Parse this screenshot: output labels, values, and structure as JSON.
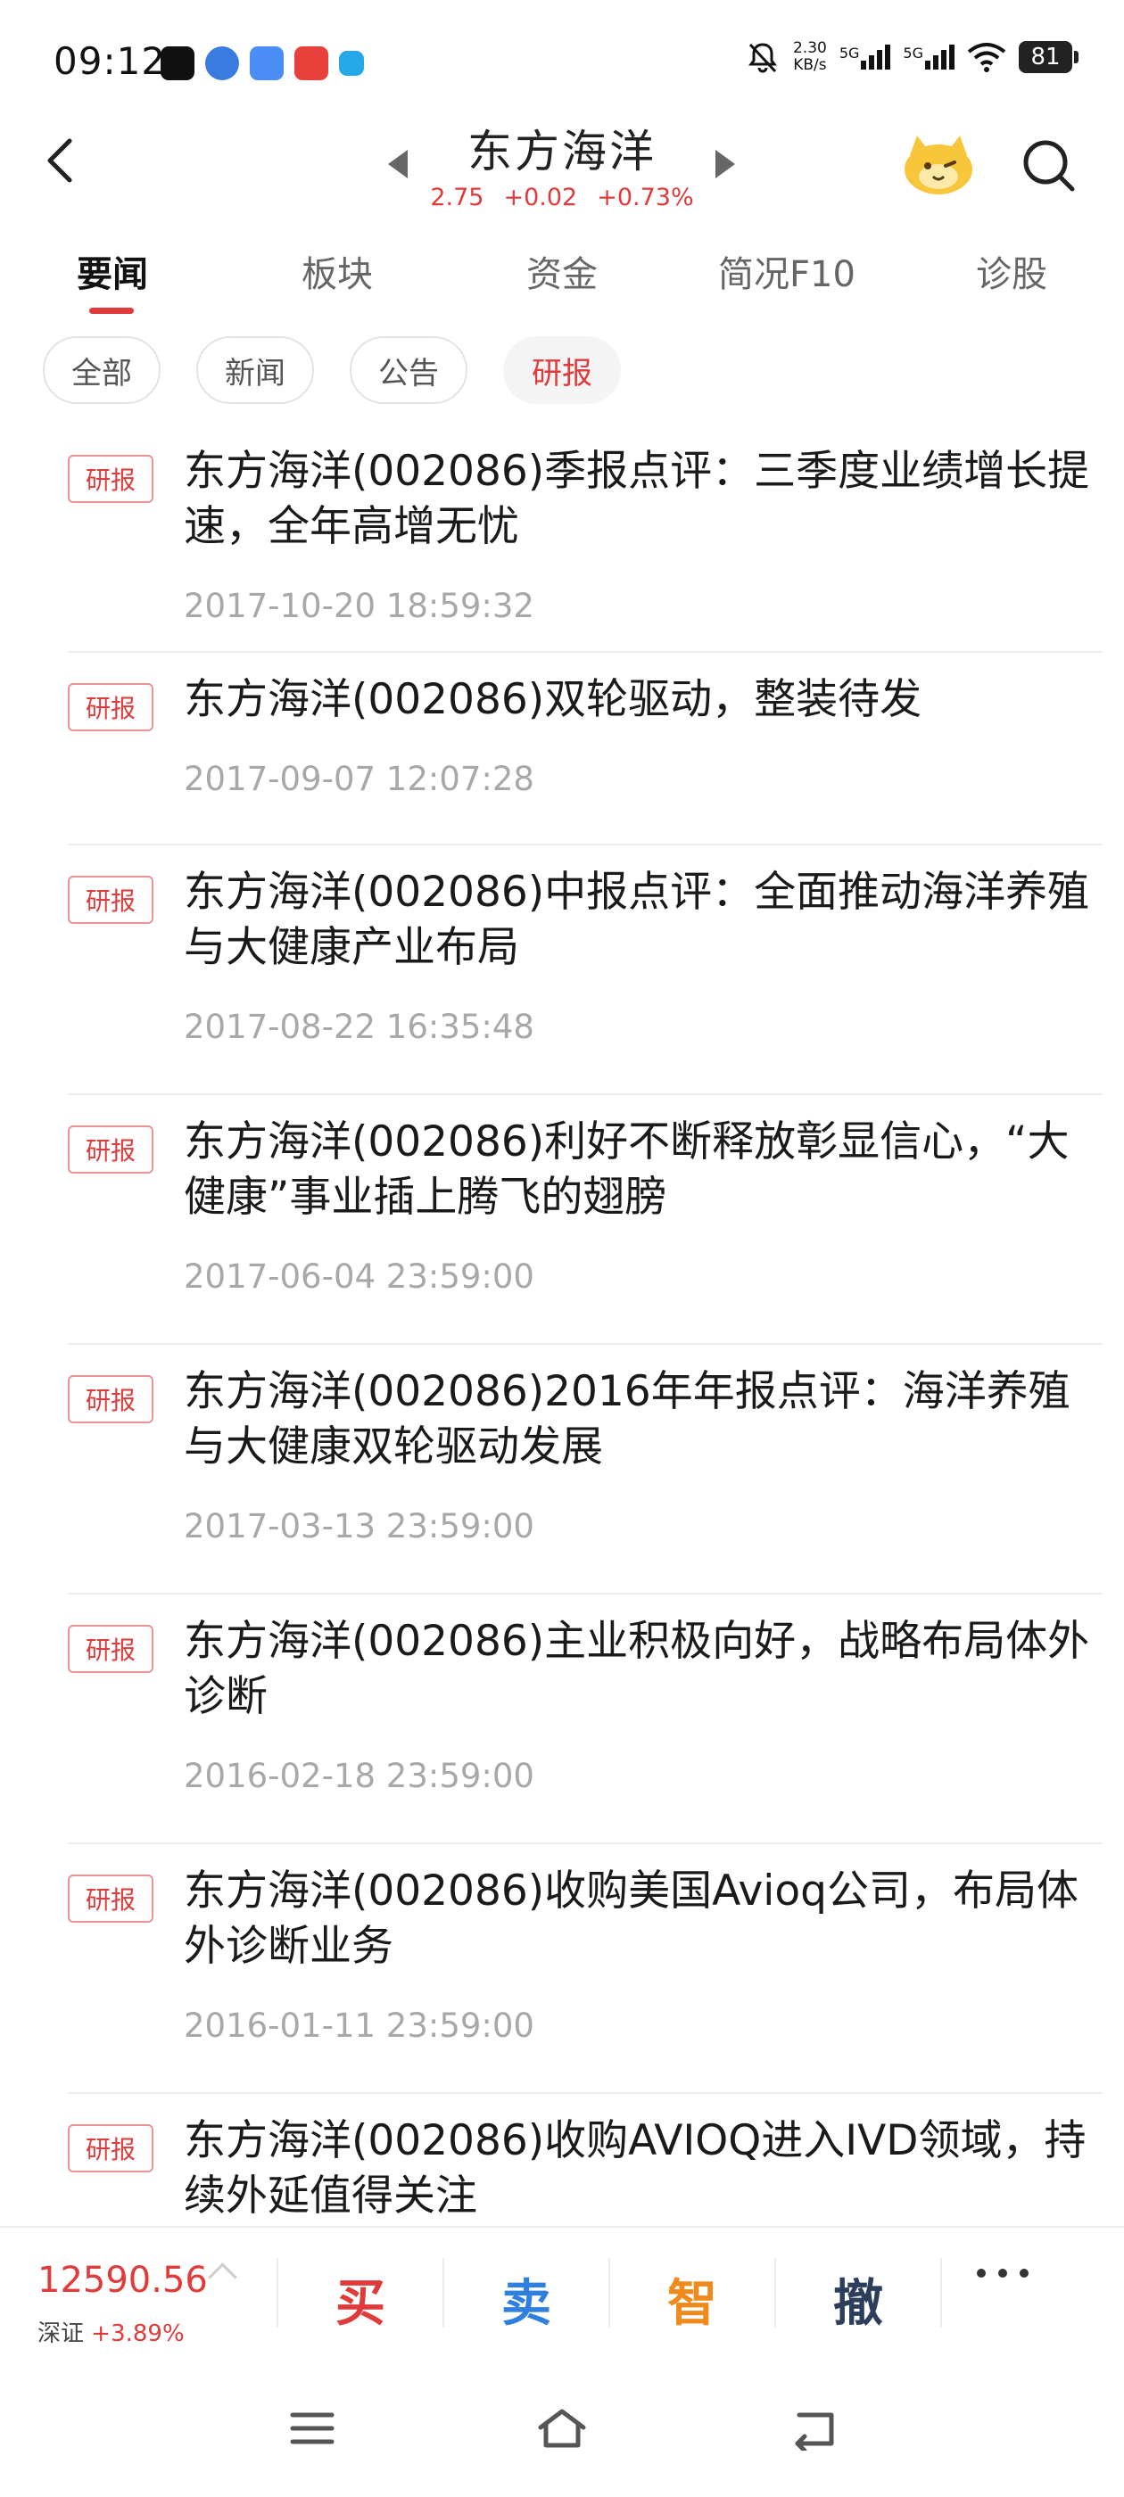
{
  "status_bar": {
    "time": "09:12",
    "net_speed_value": "2.30",
    "net_speed_unit": "KB/s",
    "sim1": "5G",
    "sim2": "5G",
    "battery": "81"
  },
  "header": {
    "stock_name": "东方海洋",
    "price": "2.75",
    "change": "+0.02",
    "change_pct": "+0.73%"
  },
  "tabs": [
    {
      "label": "要闻",
      "active": true
    },
    {
      "label": "板块",
      "active": false
    },
    {
      "label": "资金",
      "active": false
    },
    {
      "label": "简况F10",
      "active": false
    },
    {
      "label": "诊股",
      "active": false
    }
  ],
  "filters": [
    {
      "label": "全部",
      "active": false
    },
    {
      "label": "新闻",
      "active": false
    },
    {
      "label": "公告",
      "active": false
    },
    {
      "label": "研报",
      "active": true
    }
  ],
  "reports": [
    {
      "tag": "研报",
      "title": "东方海洋(002086)季报点评：三季度业绩增长提速，全年高增无忧",
      "time": "2017-10-20 18:59:32"
    },
    {
      "tag": "研报",
      "title": "东方海洋(002086)双轮驱动，整装待发",
      "time": "2017-09-07 12:07:28"
    },
    {
      "tag": "研报",
      "title": "东方海洋(002086)中报点评：全面推动海洋养殖与大健康产业布局",
      "time": "2017-08-22 16:35:48"
    },
    {
      "tag": "研报",
      "title": "东方海洋(002086)利好不断释放彰显信心，“大健康”事业插上腾飞的翅膀",
      "time": "2017-06-04 23:59:00"
    },
    {
      "tag": "研报",
      "title": "东方海洋(002086)2016年年报点评：海洋养殖与大健康双轮驱动发展",
      "time": "2017-03-13 23:59:00"
    },
    {
      "tag": "研报",
      "title": "东方海洋(002086)主业积极向好，战略布局体外诊断",
      "time": "2016-02-18 23:59:00"
    },
    {
      "tag": "研报",
      "title": "东方海洋(002086)收购美国Avioq公司，布局体外诊断业务",
      "time": "2016-01-11 23:59:00"
    },
    {
      "tag": "研报",
      "title": "东方海洋(002086)收购AVIOQ进入IVD领域，持续外延值得关注",
      "time": ""
    }
  ],
  "trade_bar": {
    "index_value": "12590.56",
    "index_name": "深证",
    "index_change": "+3.89%",
    "buy": "买",
    "sell": "卖",
    "smart": "智",
    "cancel": "撤"
  },
  "colors": {
    "accent_red": "#e03a3a",
    "sell_blue": "#2f7fe0",
    "smart_orange": "#f08a1c",
    "cancel_navy": "#2c3e5c"
  }
}
